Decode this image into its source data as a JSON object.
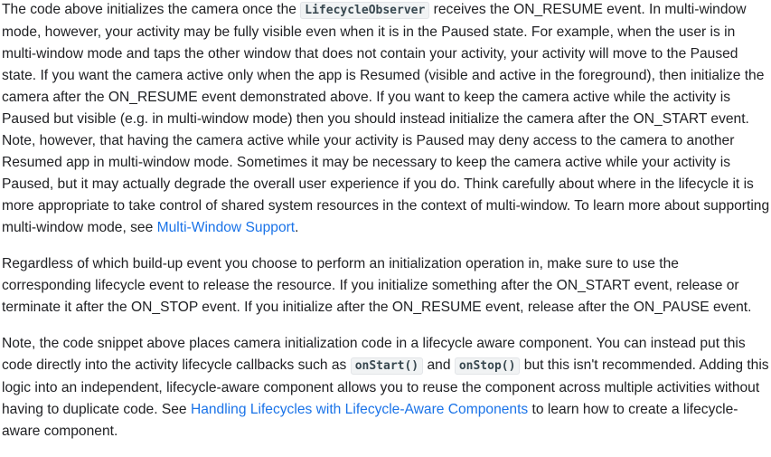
{
  "paragraphs": [
    {
      "p1_a": "The code above initializes the camera once the ",
      "p1_code": "LifecycleObserver",
      "p1_b": " receives the ON_RESUME event. In multi-window mode, however, your activity may be fully visible even when it is in the Paused state. For example, when the user is in multi-window mode and taps the other window that does not contain your activity, your activity will move to the Paused state. If you want the camera active only when the app is Resumed (visible and active in the foreground), then initialize the camera after the ON_RESUME event demonstrated above. If you want to keep the camera active while the activity is Paused but visible (e.g. in multi-window mode) then you should instead initialize the camera after the ON_START event. Note, however, that having the camera active while your activity is Paused may deny access to the camera to another Resumed app in multi-window mode. Sometimes it may be necessary to keep the camera active while your activity is Paused, but it may actually degrade the overall user experience if you do. Think carefully about where in the lifecycle it is more appropriate to take control of shared system resources in the context of multi-window. To learn more about supporting multi-window mode, see ",
      "p1_link": "Multi-Window Support",
      "p1_c": "."
    },
    {
      "p2_text": "Regardless of which build-up event you choose to perform an initialization operation in, make sure to use the corresponding lifecycle event to release the resource. If you initialize something after the ON_START event, release or terminate it after the ON_STOP event. If you initialize after the ON_RESUME event, release after the ON_PAUSE event."
    },
    {
      "p3_a": "Note, the code snippet above places camera initialization code in a lifecycle aware component. You can instead put this code directly into the activity lifecycle callbacks such as ",
      "p3_code1": "onStart()",
      "p3_b": " and ",
      "p3_code2": "onStop()",
      "p3_c": " but this isn't recommended. Adding this logic into an independent, lifecycle-aware component allows you to reuse the component across multiple activities without having to duplicate code. See ",
      "p3_link": "Handling Lifecycles with Lifecycle-Aware Components",
      "p3_d": " to learn how to create a lifecycle-aware component."
    }
  ],
  "colors": {
    "text": "#202124",
    "link": "#1a73e8",
    "code_text": "#37474f",
    "code_bg": "#f1f3f4"
  }
}
